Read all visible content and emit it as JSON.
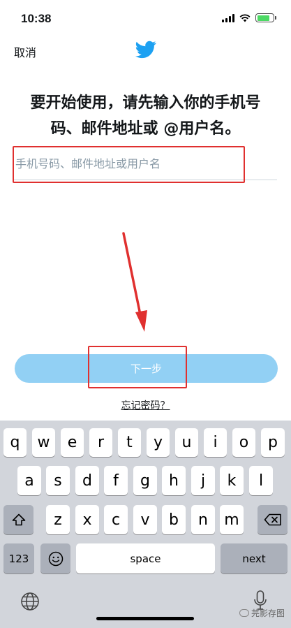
{
  "status_bar": {
    "time": "10:38"
  },
  "nav": {
    "cancel_label": "取消",
    "logo_icon": "twitter-bird-icon",
    "brand_color": "#1da1f2"
  },
  "main": {
    "headline_line1": "要开始使用，请先输入你的手机号",
    "headline_line2": "码、邮件地址或 @用户名。",
    "input_placeholder": "手机号码、邮件地址或用户名",
    "input_value": "",
    "next_label": "下一步",
    "forgot_label": "忘记密码？"
  },
  "annotations": {
    "highlight_color": "#e0302f"
  },
  "keyboard": {
    "row1": [
      "q",
      "w",
      "e",
      "r",
      "t",
      "y",
      "u",
      "i",
      "o",
      "p"
    ],
    "row2": [
      "a",
      "s",
      "d",
      "f",
      "g",
      "h",
      "j",
      "k",
      "l"
    ],
    "row3": [
      "z",
      "x",
      "c",
      "v",
      "b",
      "n",
      "m"
    ],
    "shift_icon": "shift-icon",
    "delete_icon": "delete-icon",
    "num_label": "123",
    "emoji_icon": "emoji-icon",
    "space_label": "space",
    "return_label": "next",
    "globe_icon": "globe-icon",
    "mic_icon": "microphone-icon"
  },
  "watermark": {
    "text": "芫影存图"
  }
}
